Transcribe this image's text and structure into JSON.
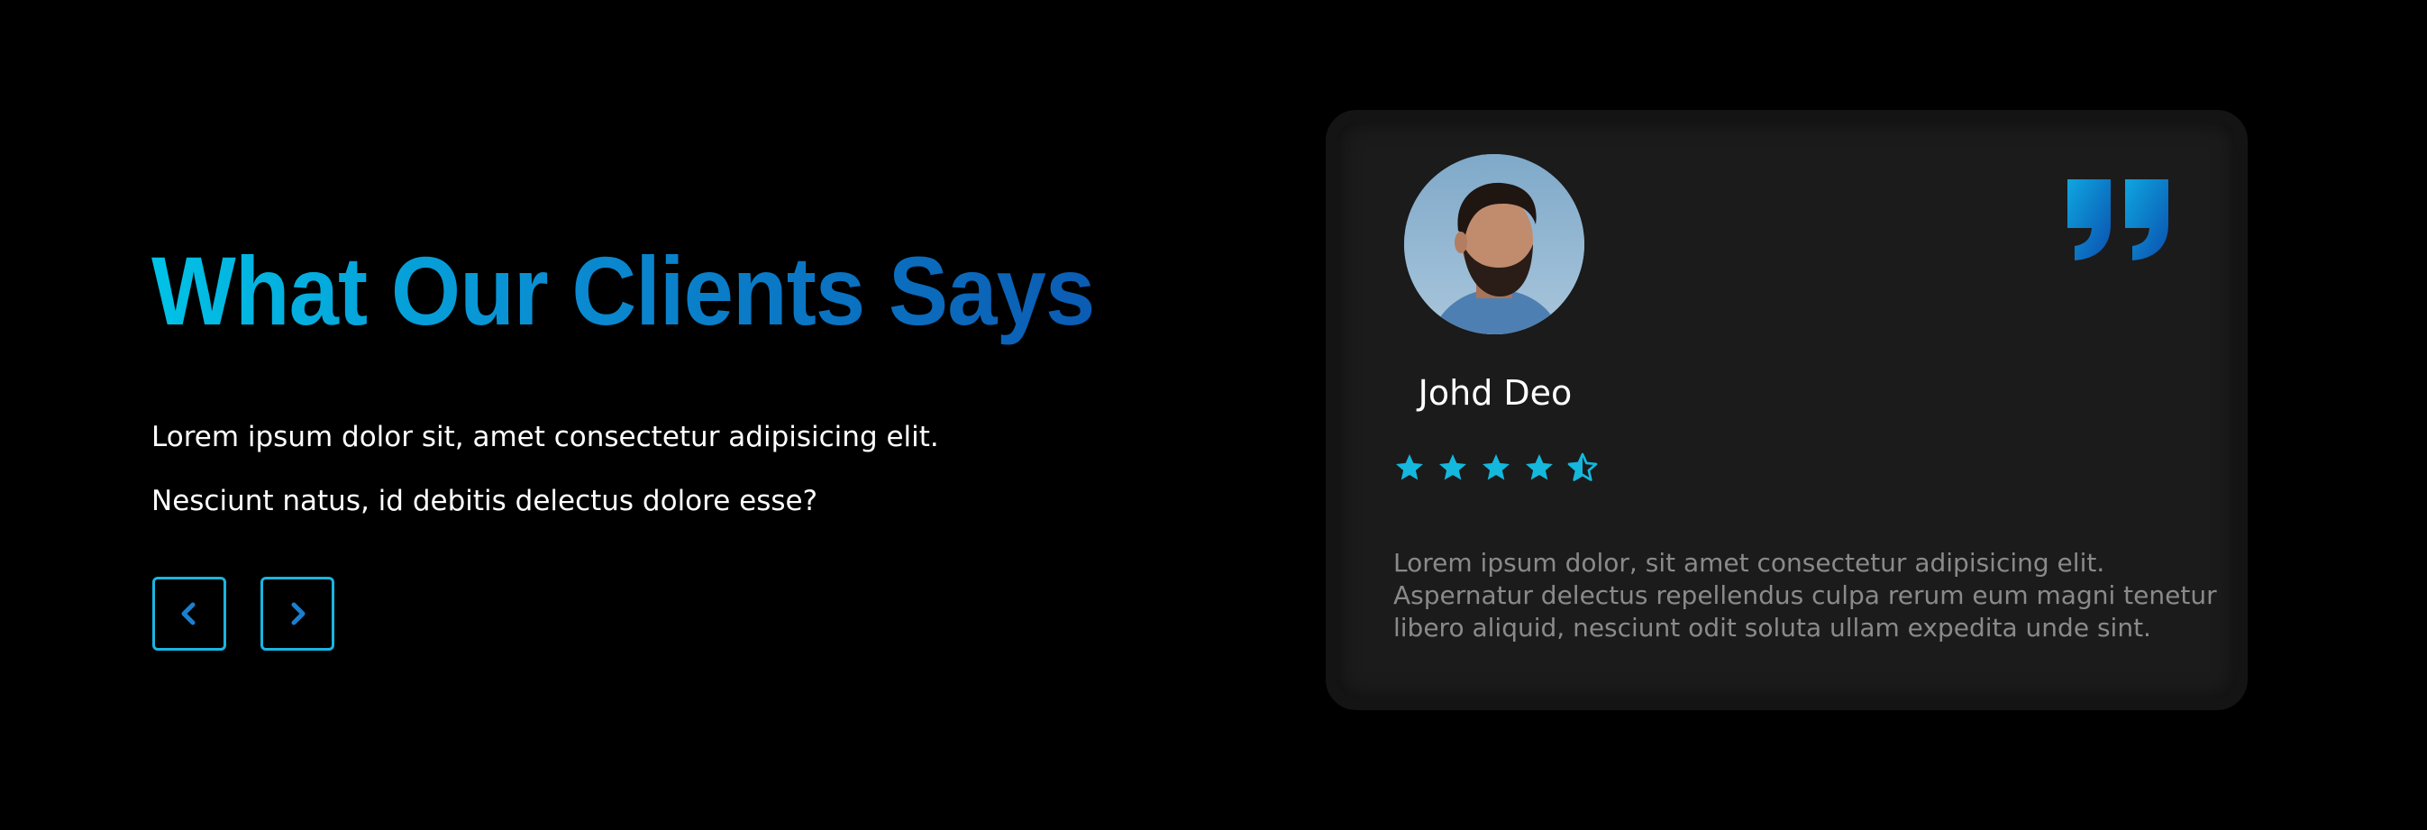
{
  "section": {
    "heading": "What Our Clients Says",
    "paragraph_1": "Lorem ipsum dolor sit, amet consectetur adipisicing elit.",
    "paragraph_2": "Nesciunt natus, id debitis delectus dolore esse?",
    "nav": {
      "prev_icon": "chevron-left-icon",
      "next_icon": "chevron-right-icon"
    }
  },
  "testimonial": {
    "name": "Johd Deo",
    "rating": 4.5,
    "rating_max": 5,
    "review_lines": [
      "Lorem ipsum dolor, sit amet consectetur adipisicing elit.",
      "Aspernatur delectus repellendus culpa rerum eum magni tenetur",
      "libero aliquid, nesciunt odit soluta ullam expedita unde sint."
    ],
    "quote_icon": "quote-icon",
    "avatar_icon": "avatar-photo"
  },
  "colors": {
    "background": "#000000",
    "accent_start": "#00c2e6",
    "accent_end": "#0b5cb3",
    "card_background": "#1b1b1b",
    "card_border": "#141414",
    "star": "#14b8dc",
    "review_text": "#8a8a8a"
  }
}
